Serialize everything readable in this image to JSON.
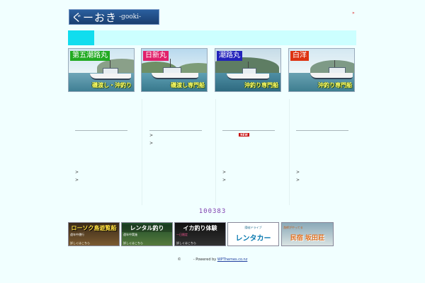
{
  "header": {
    "logo_jp": "ぐーおき",
    "logo_en": "-gooki-",
    "corner_mark": "»"
  },
  "boats": [
    {
      "name": "第五潮路丸",
      "tag": "磯渡し・沖釣り",
      "name_bg": "#22aa22"
    },
    {
      "name": "日新丸",
      "tag": "磯渡し専門船",
      "name_bg": "#e0206a"
    },
    {
      "name": "潮路丸",
      "tag": "沖釣り専門船",
      "name_bg": "#2222bb"
    },
    {
      "name": "白洋",
      "tag": "沖釣り専門船",
      "name_bg": "#dd3311"
    }
  ],
  "bullets": {
    "glyph": ">"
  },
  "badge": {
    "new": "NEW"
  },
  "counter": {
    "value": "100383"
  },
  "banners": [
    {
      "title": "ローソク島遊覧船",
      "line1": "遠年中運行",
      "line2": "詳しくはこちら"
    },
    {
      "title": "レンタル釣り",
      "line1": "遠年中実施",
      "line2": "詳しくはこちら"
    },
    {
      "title": "イカ釣り体験",
      "line1": "一日限定",
      "line2": "詳しくはこちら"
    },
    {
      "title": "レンタカー",
      "line1": "隠岐ドライブ",
      "line2": ""
    },
    {
      "title": "民宿 坂田荘",
      "line1": "漁師がやってる",
      "line2": ""
    }
  ],
  "footer": {
    "copyright": "©",
    "powered_by": "- Powered by",
    "link": "WPThemes.co.nz"
  }
}
